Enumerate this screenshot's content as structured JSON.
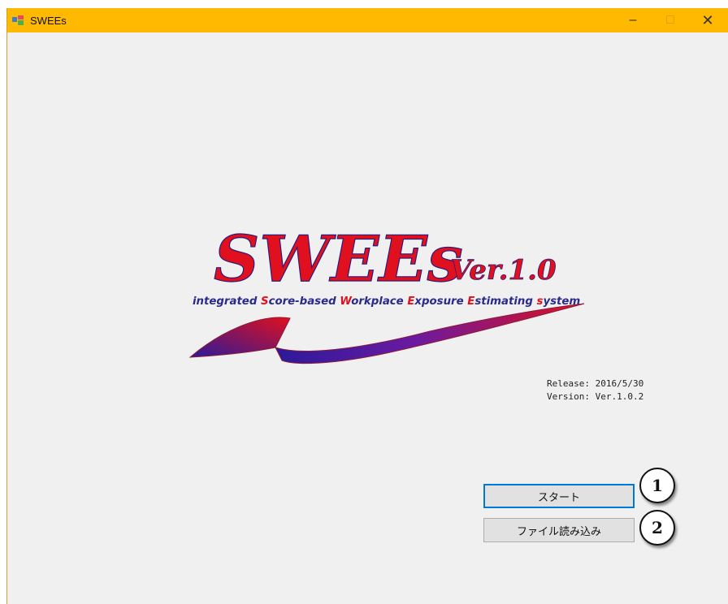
{
  "window": {
    "title": "SWEEs",
    "controls": {
      "minimize": "–",
      "maximize": "□",
      "close": "✕"
    }
  },
  "logo": {
    "name": "SWEEs",
    "version": "Ver.1.0",
    "tagline_parts": [
      {
        "text": "integrated ",
        "color": "#2a2a8c"
      },
      {
        "text": "S",
        "color": "#e0101e"
      },
      {
        "text": "core-based ",
        "color": "#2a2a8c"
      },
      {
        "text": "W",
        "color": "#e0101e"
      },
      {
        "text": "orkplace ",
        "color": "#2a2a8c"
      },
      {
        "text": "E",
        "color": "#e0101e"
      },
      {
        "text": "xposure ",
        "color": "#2a2a8c"
      },
      {
        "text": "E",
        "color": "#e0101e"
      },
      {
        "text": "stimating ",
        "color": "#2a2a8c"
      },
      {
        "text": "s",
        "color": "#e0101e"
      },
      {
        "text": "ystem",
        "color": "#2a2a8c"
      }
    ],
    "colors": {
      "red": "#e0101e",
      "navy": "#2a2a8c",
      "purple": "#5a1a9a"
    }
  },
  "release": {
    "release_line": "Release: 2016/5/30",
    "version_line": "Version: Ver.1.0.2"
  },
  "buttons": {
    "start": "スタート",
    "load_file": "ファイル読み込み"
  },
  "callouts": {
    "one": "1",
    "two": "2"
  }
}
